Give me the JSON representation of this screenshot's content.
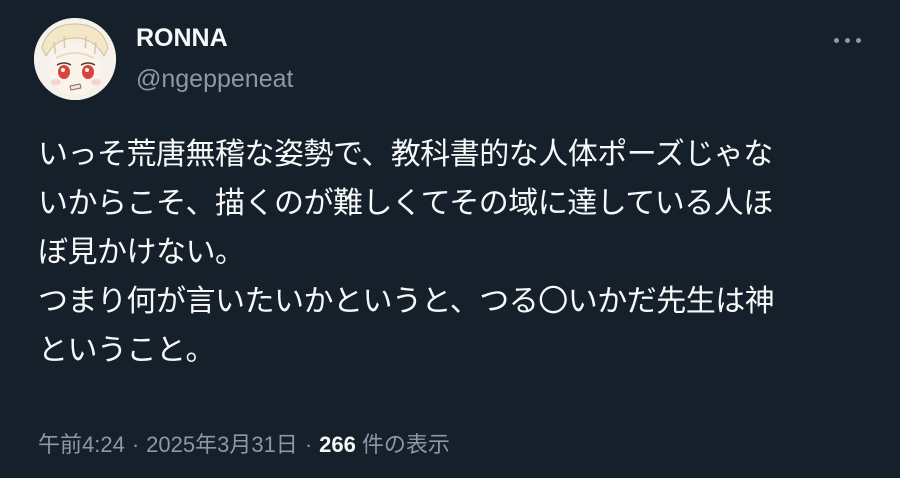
{
  "user": {
    "display_name": "RONNA",
    "handle": "@ngeppeneat",
    "avatar_icon": "avatar-illustration"
  },
  "more_menu_icon": "more-horizontal-icon",
  "tweet": {
    "lines": [
      "いっそ荒唐無稽な姿勢で、教科書的な人体ポーズじゃな",
      "いからこそ、描くのが難しくてその域に達している人ほ",
      "ぼ見かけない。",
      "つまり何が言いたいかというと、つる〇いかだ先生は神",
      "ということ。"
    ]
  },
  "meta": {
    "time": "午前4:24",
    "separator": "·",
    "date": "2025年3月31日",
    "views_count": "266",
    "views_label": "件の表示"
  },
  "colors": {
    "background": "#15202b",
    "primary_text": "#f7f9f9",
    "secondary_text": "#8b98a5"
  }
}
